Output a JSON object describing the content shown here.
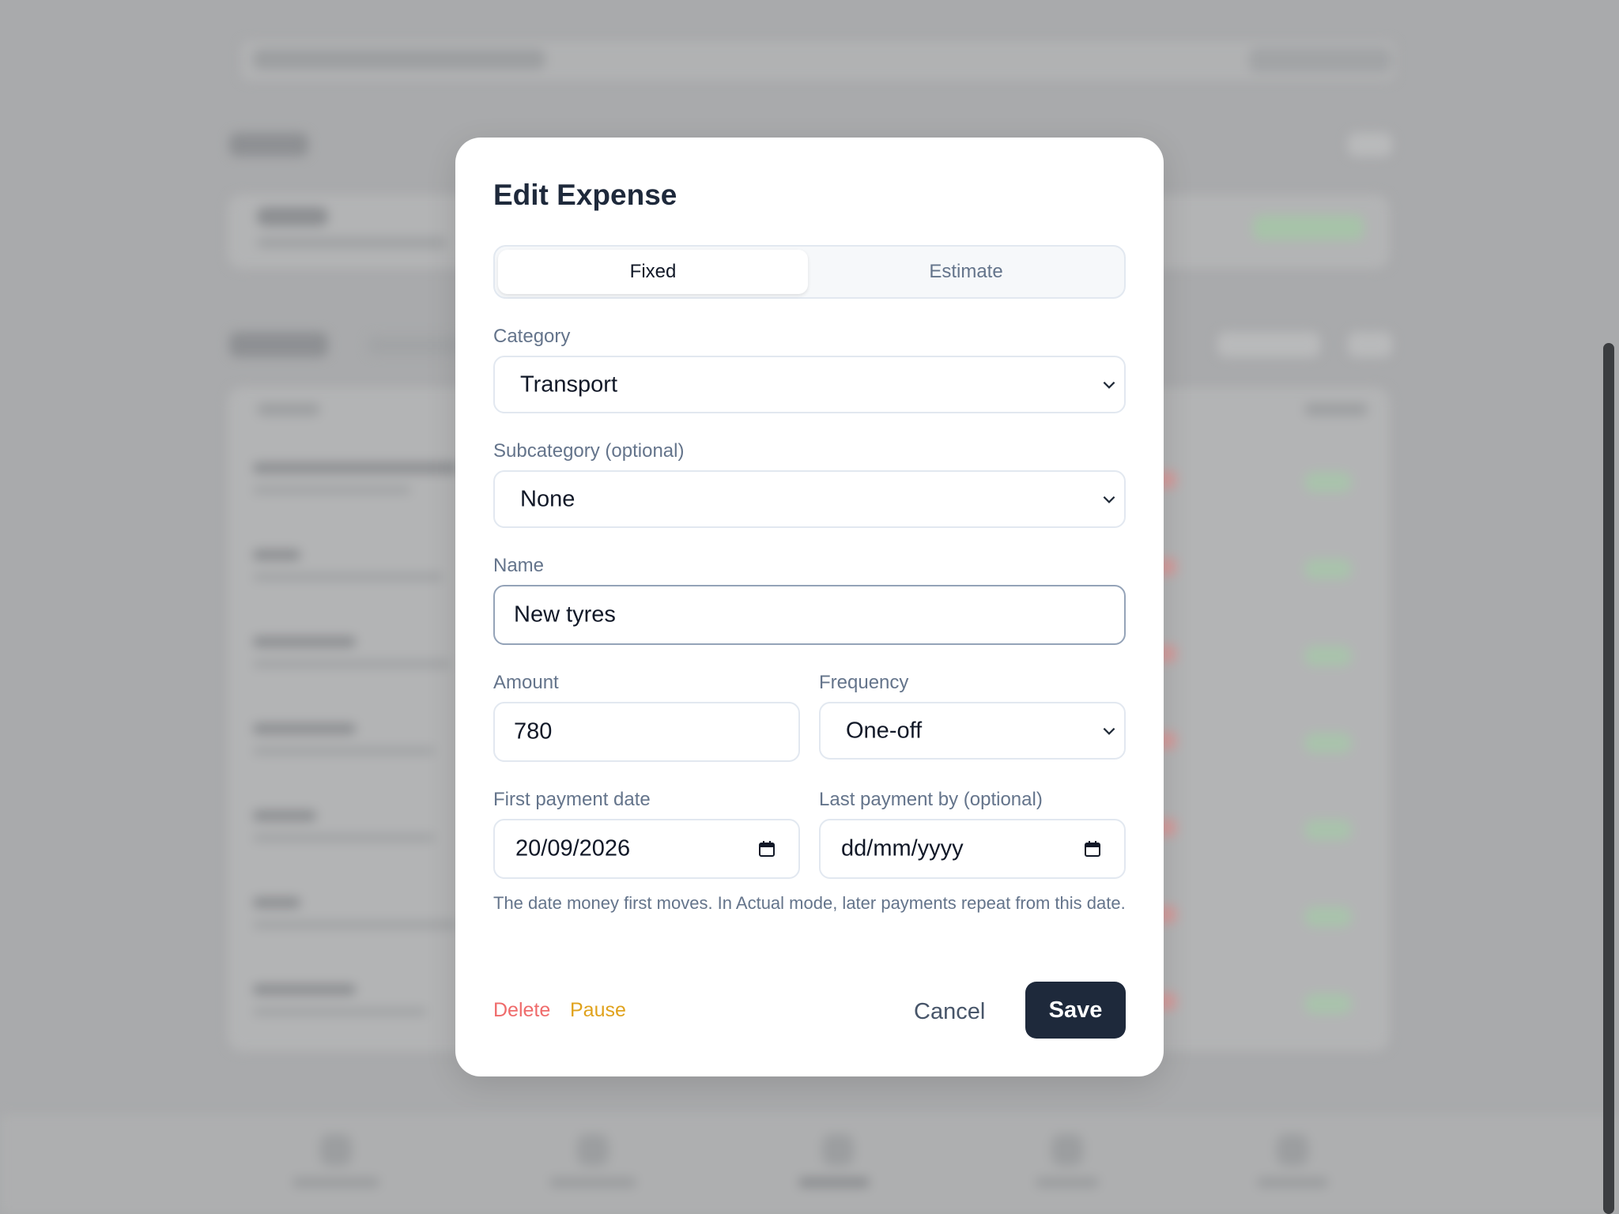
{
  "modal": {
    "title": "Edit Expense",
    "type_toggle": {
      "options": [
        "Fixed",
        "Estimate"
      ],
      "selected": "Fixed"
    },
    "category": {
      "label": "Category",
      "value": "Transport"
    },
    "subcategory": {
      "label": "Subcategory (optional)",
      "value": "None"
    },
    "name": {
      "label": "Name",
      "value": "New tyres"
    },
    "amount": {
      "label": "Amount",
      "value": "780"
    },
    "frequency": {
      "label": "Frequency",
      "value": "One-off"
    },
    "first_payment": {
      "label": "First payment date",
      "value": "20/09/2026"
    },
    "last_payment": {
      "label": "Last payment by (optional)",
      "placeholder": "dd/mm/yyyy"
    },
    "hint": "The date money first moves. In Actual mode, later payments repeat from this date.",
    "actions": {
      "delete": "Delete",
      "pause": "Pause",
      "cancel": "Cancel",
      "save": "Save"
    }
  },
  "colors": {
    "primary": "#1e293b",
    "delete": "#ef6b6b",
    "pause": "#e0a21c",
    "label": "#64748b",
    "border": "#e2e8f0"
  }
}
